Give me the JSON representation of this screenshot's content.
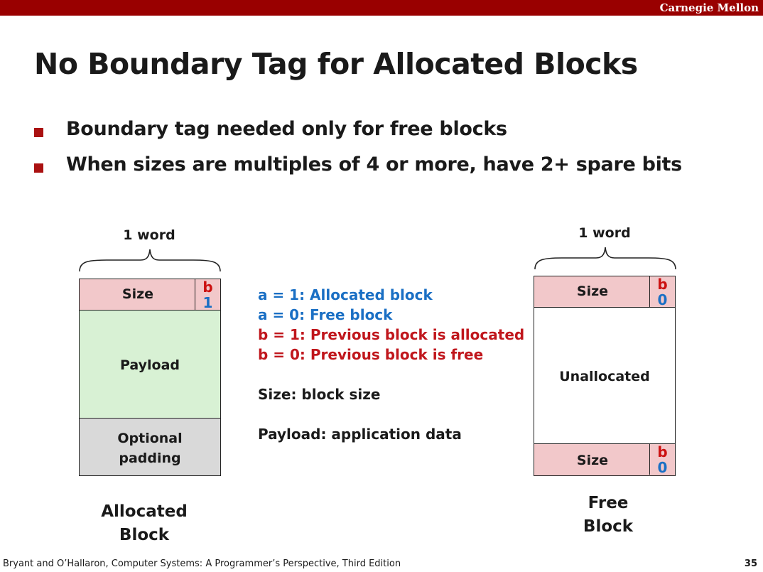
{
  "header": {
    "brand": "Carnegie Mellon"
  },
  "slide": {
    "title": "No Boundary Tag for Allocated Blocks",
    "bullets": [
      "Boundary tag needed only for free blocks",
      "When sizes are multiples of 4 or more, have 2+ spare bits"
    ]
  },
  "allocated": {
    "word_label": "1 word",
    "size_label": "Size",
    "b_letter": "b",
    "b_value": "1",
    "payload_label": "Payload",
    "padding_line1": "Optional",
    "padding_line2": "padding",
    "caption_line1": "Allocated",
    "caption_line2": "Block"
  },
  "legend": {
    "a1": "a = 1: Allocated block",
    "a0": "a = 0: Free block",
    "b1": "b = 1: Previous block is allocated",
    "b0": "b = 0: Previous block is free",
    "size": "Size: block size",
    "payload": "Payload: application data"
  },
  "free": {
    "word_label": "1 word",
    "size_label": "Size",
    "b_letter": "b",
    "b_value": "0",
    "unallocated_label": "Unallocated",
    "caption_line1": "Free",
    "caption_line2": "Block"
  },
  "footer": {
    "citation": "Bryant and O’Hallaron, Computer Systems: A Programmer’s Perspective, Third Edition",
    "page": "35"
  },
  "colors": {
    "banner": "#990000",
    "header_cell": "#f2c8ca",
    "payload": "#d8f1d4",
    "padding": "#d9d9d9",
    "blue_text": "#1a6fc4",
    "red_text": "#c0161c"
  }
}
